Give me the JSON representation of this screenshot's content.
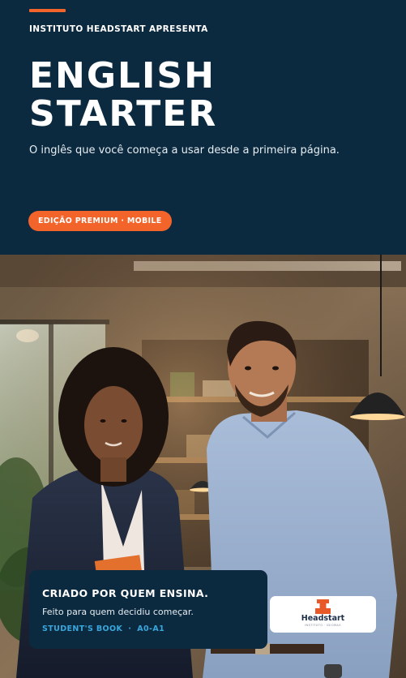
{
  "header": {
    "presenter": "INSTITUTO HEADSTART APRESENTA",
    "title_lines": [
      "ENGLISH",
      "STARTER"
    ],
    "subtitle": "O inglês que você começa a usar desde a primeira página.",
    "edition": "EDIÇÃO PREMIUM · MOBILE"
  },
  "info_card": {
    "title": "CRIADO POR QUEM ENSINA.",
    "line": "Feito para quem decidiu começar.",
    "tags": [
      "STUDENT'S BOOK",
      "A0-A1"
    ],
    "separator": "·"
  },
  "logo": {
    "name": "Headstart",
    "tagline": "INSTITUTO · IDIOMAS"
  },
  "colors": {
    "navy": "#0c2a3f",
    "accent": "#f2642a",
    "tag_blue": "#39a7dd"
  },
  "icons": {
    "logo_mark": "headstart-logo-icon"
  }
}
